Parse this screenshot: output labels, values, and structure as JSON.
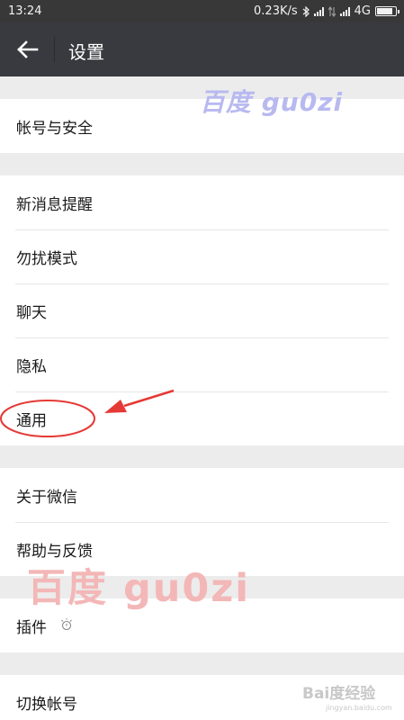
{
  "status_bar": {
    "time": "13:24",
    "network_speed": "0.23K/s",
    "network_type": "4G",
    "battery_level": 0.85,
    "icons": [
      "bluetooth-icon",
      "signal-icon",
      "data-transfer-icon",
      "signal-icon",
      "battery-icon"
    ]
  },
  "header": {
    "title": "设置",
    "back_icon": "arrow-left-icon"
  },
  "settings": {
    "group1": [
      {
        "label": "帐号与安全"
      }
    ],
    "group2": [
      {
        "label": "新消息提醒"
      },
      {
        "label": "勿扰模式"
      },
      {
        "label": "聊天"
      },
      {
        "label": "隐私"
      },
      {
        "label": "通用"
      }
    ],
    "group3": [
      {
        "label": "关于微信"
      },
      {
        "label": "帮助与反馈"
      }
    ],
    "group4": [
      {
        "label": "插件",
        "icon": "plugin-bulb-icon"
      }
    ],
    "group5": [
      {
        "label": "切换帐号"
      }
    ]
  },
  "watermarks": {
    "top_text": "百度 gu0zi",
    "bottom_text": "百度  gu0zi",
    "corner_text": "Bai度经验",
    "corner_url": "jingyan.baidu.com"
  },
  "annotation": {
    "highlight_color": "#e53935",
    "target": "通用"
  },
  "colors": {
    "status_bar": "#383838",
    "title_bar": "#393a3f",
    "background": "#ececec",
    "row": "#ffffff"
  }
}
